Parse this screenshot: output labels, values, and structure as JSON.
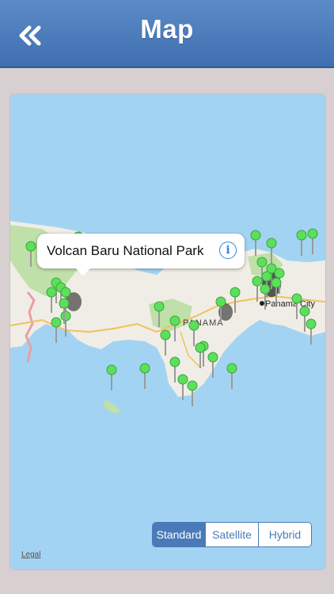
{
  "header": {
    "title": "Map",
    "back_icon": "double-chevron-left-icon"
  },
  "map": {
    "callout": {
      "title": "Volcan Baru National Park",
      "info_icon": "info-icon",
      "info_glyph": "i"
    },
    "labels": {
      "country": "PANAMA",
      "city": "Panama City"
    },
    "map_type": {
      "options": [
        "Standard",
        "Satellite",
        "Hybrid"
      ],
      "selected": "Standard"
    },
    "legal": "Legal",
    "colors": {
      "water": "#a3d3f2",
      "land": "#f0ede6",
      "park": "#bfe0a8",
      "pin": "#5ce05c",
      "road": "#f2c15a",
      "accent": "#4a7bb8"
    }
  }
}
